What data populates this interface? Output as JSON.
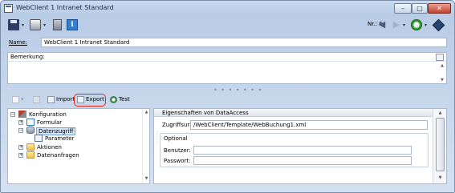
{
  "window": {
    "title": "WebClient 1 Intranet Standard",
    "controls": {
      "minimize": "–",
      "maximize": "□",
      "close": "✕"
    }
  },
  "toolbar": {
    "record_label": "Nr.: 6",
    "icons": [
      "save-icon",
      "print-icon",
      "delete-icon",
      "info-icon",
      "back-arrow-icon",
      "forward-arrow-icon",
      "clock-icon",
      "book-icon"
    ],
    "dropdown_glyph": "▾"
  },
  "form": {
    "name_label": "Name:",
    "name_value": "WebClient 1 Intranet Standard",
    "remark_label": "Bemerkung:",
    "remark_value": ""
  },
  "secondary_toolbar": {
    "import_label": "Import",
    "export_label": "Export",
    "test_label": "Test"
  },
  "tree": {
    "nodes": [
      {
        "label": "Konfiguration",
        "expander": "−"
      },
      {
        "label": "Formular",
        "expander": "+"
      },
      {
        "label": "Datenzugriff",
        "expander": "−",
        "selected": true
      },
      {
        "label": "Parameter",
        "expander": ""
      },
      {
        "label": "Aktionen",
        "expander": "+"
      },
      {
        "label": "Datenanfragen",
        "expander": "+"
      }
    ]
  },
  "properties": {
    "header": "Eigenschaften von DataAccess",
    "zugriffsurl_label": "Zugriffsurl:",
    "zugriffsurl_value": "/WebClient/Template/WebBuchung1.xml",
    "optional_label": "Optional",
    "benutzer_label": "Benutzer:",
    "benutzer_value": "",
    "passwort_label": "Passwort:",
    "passwort_value": ""
  },
  "colors": {
    "accent": "#e0251b",
    "selection": "#cfe3fb",
    "chrome": "#bfd0e8"
  }
}
